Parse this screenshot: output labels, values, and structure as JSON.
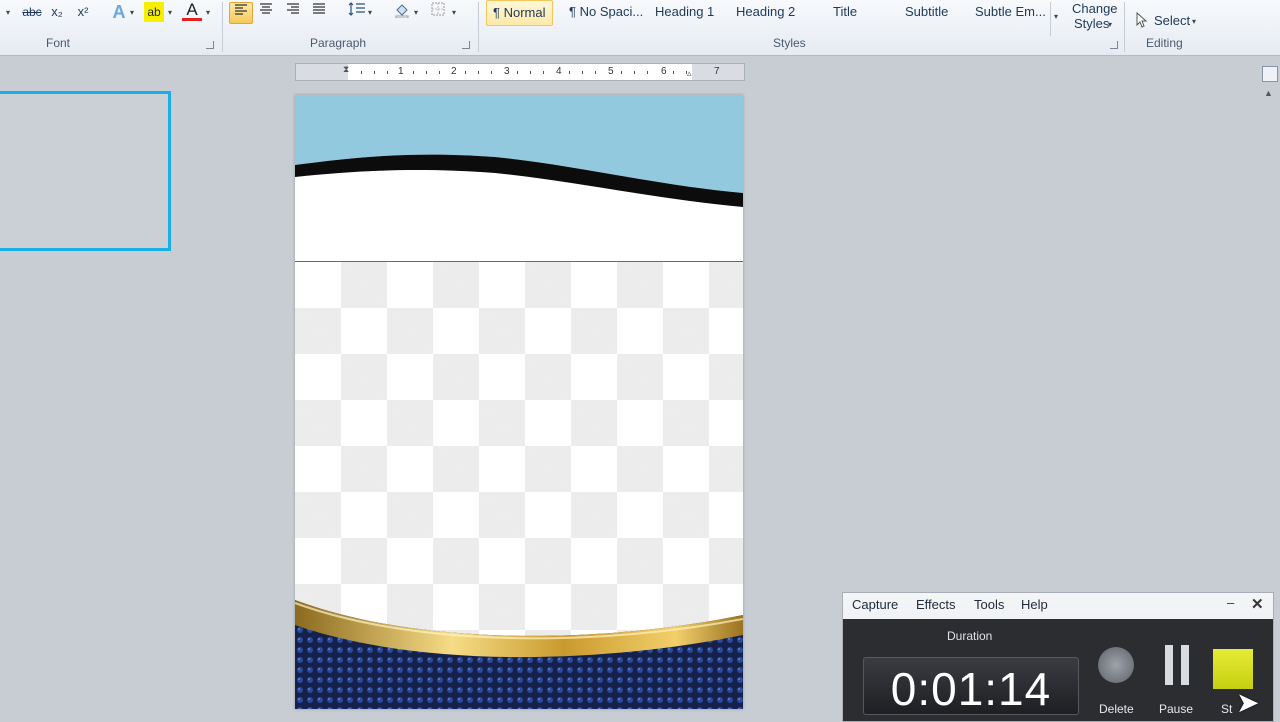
{
  "ribbon": {
    "font": {
      "group_label": "Font",
      "strikethrough": "abc",
      "subscript": "x₂",
      "superscript": "x²",
      "text_effects": "A",
      "highlight": "ab",
      "font_color": "A"
    },
    "paragraph": {
      "group_label": "Paragraph"
    },
    "styles": {
      "group_label": "Styles",
      "items": [
        "¶ Normal",
        "¶ No Spaci...",
        "Heading 1",
        "Heading 2",
        "Title",
        "Subtitle",
        "Subtle Em..."
      ],
      "change_styles": [
        "Change",
        "Styles"
      ]
    },
    "editing": {
      "group_label": "Editing",
      "select_label": "Select"
    }
  },
  "ruler": {
    "numbers": [
      "1",
      "2",
      "3",
      "4",
      "5",
      "6",
      "7"
    ]
  },
  "recorder": {
    "menu": [
      "Capture",
      "Effects",
      "Tools",
      "Help"
    ],
    "minimize": "–",
    "close": "✕",
    "duration_label": "Duration",
    "duration_value": "0:01:14",
    "delete_label": "Delete",
    "pause_label": "Pause",
    "stop_label": "St"
  },
  "colors": {
    "accent_selection": "#19aee8",
    "header_blue": "#92c9df",
    "navy": "#1b2a5c",
    "gold": "#c9a035"
  }
}
